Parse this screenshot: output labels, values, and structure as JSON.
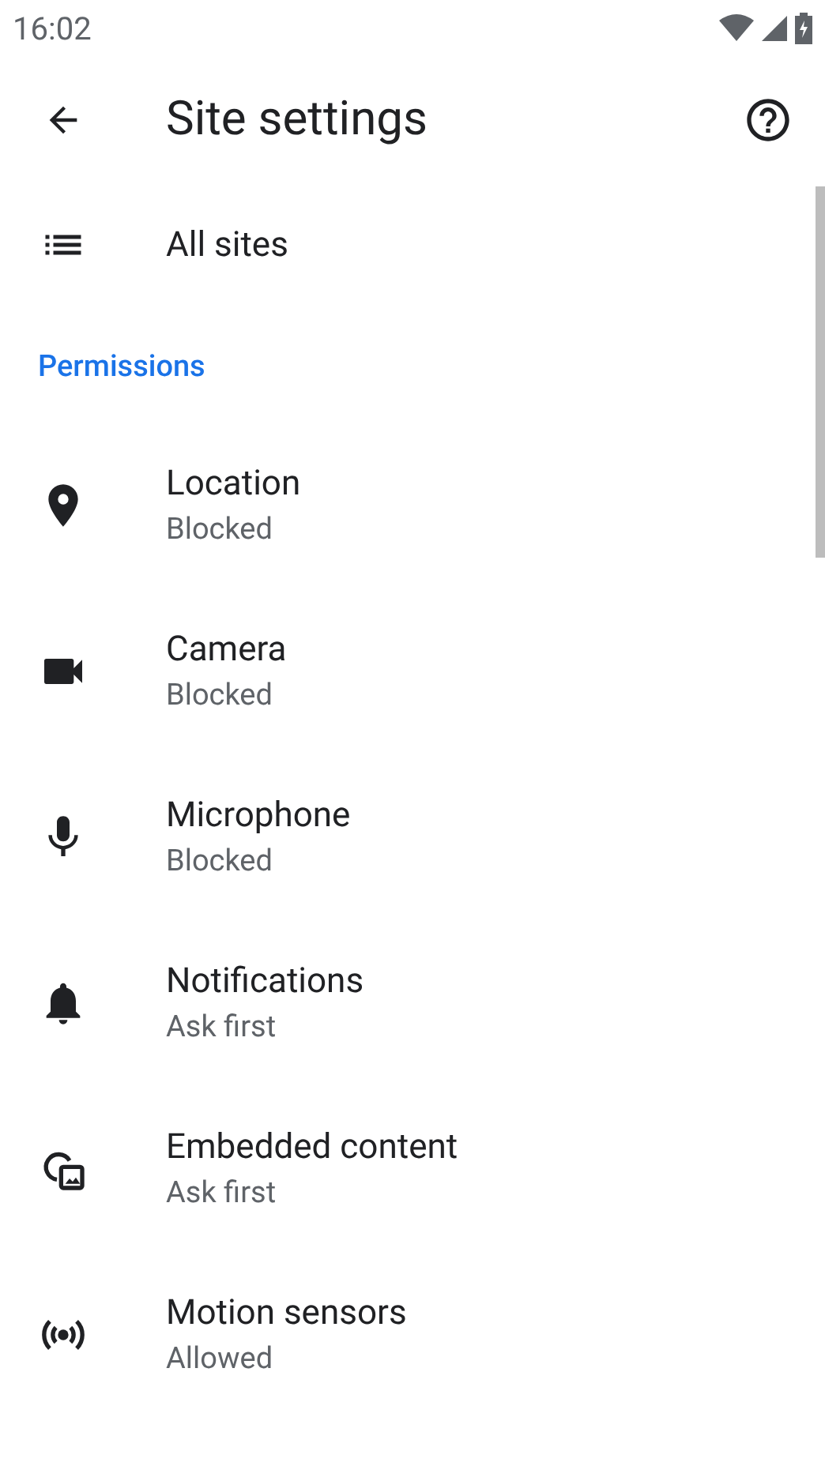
{
  "status_bar": {
    "time": "16:02"
  },
  "app_bar": {
    "title": "Site settings"
  },
  "all_sites": {
    "label": "All sites"
  },
  "section": {
    "title": "Permissions"
  },
  "permissions": [
    {
      "kind": "location",
      "title": "Location",
      "status": "Blocked"
    },
    {
      "kind": "camera",
      "title": "Camera",
      "status": "Blocked"
    },
    {
      "kind": "microphone",
      "title": "Microphone",
      "status": "Blocked"
    },
    {
      "kind": "notifications",
      "title": "Notifications",
      "status": "Ask first"
    },
    {
      "kind": "embedded",
      "title": "Embedded content",
      "status": "Ask first"
    },
    {
      "kind": "motion",
      "title": "Motion sensors",
      "status": "Allowed"
    }
  ]
}
